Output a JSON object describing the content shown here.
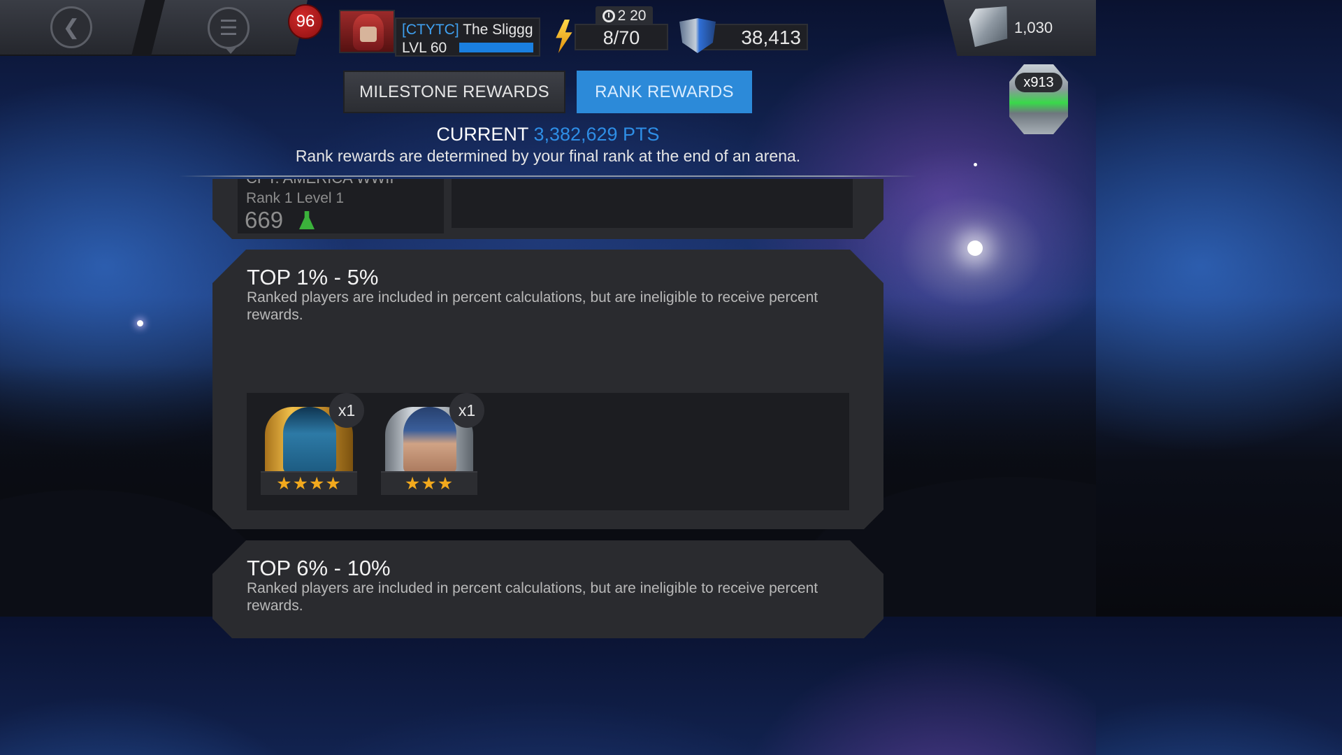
{
  "header": {
    "notification_count": "96",
    "alliance_tag": "[CTYTC]",
    "player_name": "The Sliggg",
    "level_label": "LVL 60",
    "timer": "2 20",
    "energy": "8/70",
    "units": "38,413",
    "gold": "1,030",
    "crystals": "x913"
  },
  "tabs": [
    {
      "label": "MILESTONE REWARDS"
    },
    {
      "label": "RANK REWARDS"
    }
  ],
  "current": {
    "label": "CURRENT",
    "points": "3,382,629 PTS",
    "note": "Rank rewards are determined by your final rank at the end of an arena."
  },
  "partial_panel": {
    "title": "CPT. AMERICA WWII",
    "subtitle": "Rank 1 Level 1",
    "value": "669"
  },
  "tiers": [
    {
      "title": "TOP 1% - 5%",
      "description": "Ranked players are included in percent calculations, but are ineligible to receive percent rewards.",
      "rewards": [
        {
          "icon": "beast-portrait",
          "stars": "★★★★",
          "quantity": "x1"
        },
        {
          "icon": "captain-america-portrait",
          "stars": "★★★",
          "quantity": "x1"
        }
      ]
    },
    {
      "title": "TOP 6% - 10%",
      "description": "Ranked players are included in percent calculations, but are ineligible to receive percent rewards."
    }
  ],
  "colors": {
    "accent_blue": "#2c8ad9",
    "badge_red": "#c42222",
    "star_gold": "#f2a91d"
  }
}
